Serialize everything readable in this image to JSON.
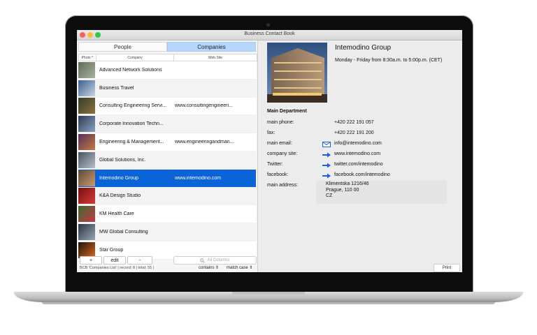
{
  "window": {
    "title": "Business Contact Book"
  },
  "tabs": [
    {
      "label": "People",
      "active": false
    },
    {
      "label": "Companies",
      "active": true
    }
  ],
  "columns": {
    "photo": "Photo ^",
    "company": "Company",
    "website": "Web Site"
  },
  "rows": [
    {
      "company": "Advanced Network Solutions",
      "website": "",
      "selected": false,
      "thumb_colors": [
        "#5f6b5a",
        "#a9b39c"
      ]
    },
    {
      "company": "Business Travel",
      "website": "",
      "selected": false,
      "thumb_colors": [
        "#3c5f8c",
        "#c9d7e6"
      ]
    },
    {
      "company": "Consulting Engineering Servi...",
      "website": "www.consultingengineeri...",
      "selected": false,
      "thumb_colors": [
        "#34402c",
        "#8c6f3a"
      ]
    },
    {
      "company": "Corporate Innovation Techn...",
      "website": "",
      "selected": false,
      "thumb_colors": [
        "#2e3c52",
        "#8aa1c2"
      ]
    },
    {
      "company": "Engineering & Management...",
      "website": "www.engineeringandman...",
      "selected": false,
      "thumb_colors": [
        "#5a2f5f",
        "#c27a3c"
      ]
    },
    {
      "company": "Global Solutions, Inc.",
      "website": "",
      "selected": false,
      "thumb_colors": [
        "#48525e",
        "#b8c2cc"
      ]
    },
    {
      "company": "Intemodino Group",
      "website": "www.intemodino.com",
      "selected": true,
      "thumb_colors": [
        "#5e4a3a",
        "#c99a6a"
      ]
    },
    {
      "company": "K&A Design Studio",
      "website": "",
      "selected": false,
      "thumb_colors": [
        "#7a0f0f",
        "#d43a3a"
      ]
    },
    {
      "company": "KM Health Care",
      "website": "",
      "selected": false,
      "thumb_colors": [
        "#3a6a2a",
        "#c23a4a"
      ]
    },
    {
      "company": "MW Global Consulting",
      "website": "",
      "selected": false,
      "thumb_colors": [
        "#2a3442",
        "#9aa6b4"
      ]
    },
    {
      "company": "Star Group",
      "website": "",
      "selected": false,
      "thumb_colors": [
        "#1a1410",
        "#e06a1a"
      ]
    }
  ],
  "buttons": {
    "add": "+",
    "edit": "edit",
    "remove": "-"
  },
  "search": {
    "placeholder": "All Columns"
  },
  "status": {
    "text": "BCB 'Companies List'  |  record: 8  |  total: 55  |",
    "match_mode": "contains",
    "case_mode": "match case"
  },
  "detail": {
    "name": "Intemodino Group",
    "hours": "Monday - Friday from 8:30a.m. to 5:00p.m. (CET)",
    "department": "Main Department",
    "fields": [
      {
        "label": "main phone:",
        "value": "+420 222 191 057",
        "icon": ""
      },
      {
        "label": "fax:",
        "value": "+420 222 191 200",
        "icon": ""
      },
      {
        "label": "main email:",
        "value": "info@intemodino.com",
        "icon": "email-icon"
      },
      {
        "label": "company site:",
        "value": "www.intemodino.com",
        "icon": "arrow-right-icon"
      },
      {
        "label": "Twitter:",
        "value": "twitter.com/intemodino",
        "icon": "arrow-right-icon"
      },
      {
        "label": "facebook:",
        "value": "facebook.com/intemodino",
        "icon": "arrow-right-icon"
      }
    ],
    "address_label": "main address:",
    "address_lines": [
      "Klimentska 1216/46",
      "Prague, 110 00",
      "CZ"
    ],
    "print_label": "Print"
  },
  "colors": {
    "selection": "#0a64d8",
    "tab_active": "#b6d7fb",
    "link_arrow": "#1d5fe0"
  }
}
